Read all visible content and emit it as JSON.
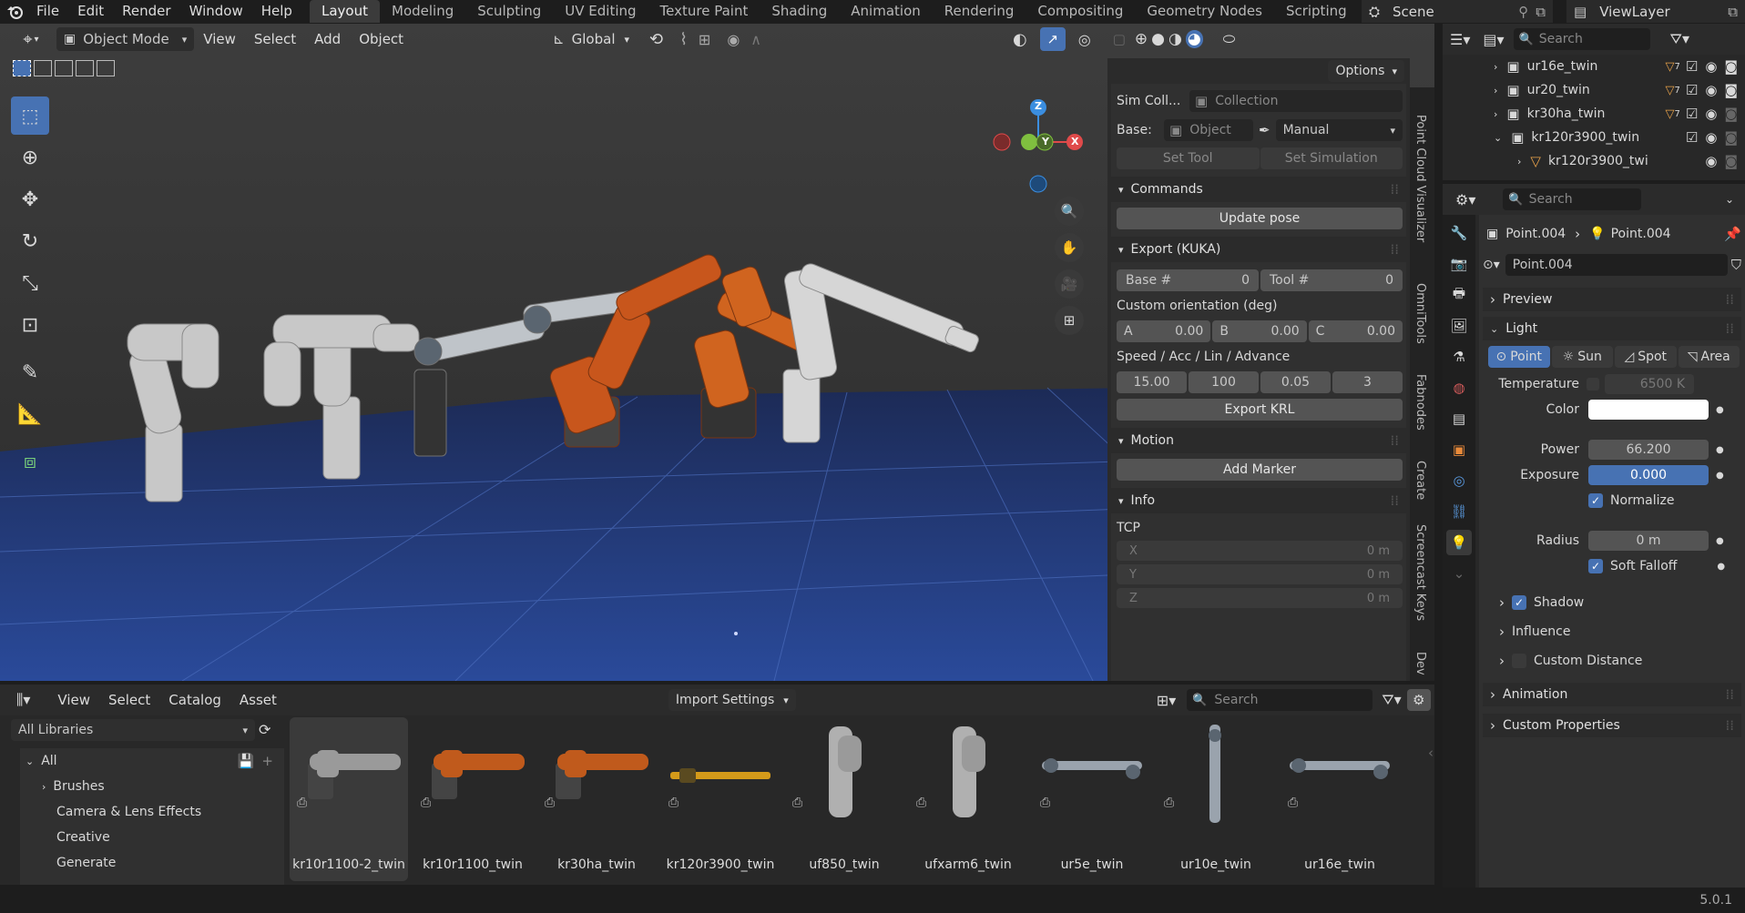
{
  "topbar": {
    "menus": [
      "File",
      "Edit",
      "Render",
      "Window",
      "Help"
    ],
    "workspaces": [
      "Layout",
      "Modeling",
      "Sculpting",
      "UV Editing",
      "Texture Paint",
      "Shading",
      "Animation",
      "Rendering",
      "Compositing",
      "Geometry Nodes",
      "Scripting"
    ],
    "active_workspace": "Layout",
    "scene": "Scene",
    "view_layer": "ViewLayer"
  },
  "viewport": {
    "mode": "Object Mode",
    "menus": [
      "View",
      "Select",
      "Add",
      "Object"
    ],
    "transform_orientation": "Global",
    "options_label": "Options",
    "gizmo_axes": {
      "z": "Z",
      "y": "Y",
      "x": "X"
    }
  },
  "npanel": {
    "sim_coll_label": "Sim Coll...",
    "sim_coll_value": "Collection",
    "base_label": "Base:",
    "base_value": "Object",
    "base_mode": "Manual",
    "set_tool": "Set Tool",
    "set_simulation": "Set Simulation",
    "commands_title": "Commands",
    "update_pose": "Update pose",
    "export_title": "Export (KUKA)",
    "base_num_label": "Base #",
    "base_num_value": "0",
    "tool_num_label": "Tool #",
    "tool_num_value": "0",
    "custom_orientation_label": "Custom orientation (deg)",
    "orient_a_label": "A",
    "orient_a_value": "0.00",
    "orient_b_label": "B",
    "orient_b_value": "0.00",
    "orient_c_label": "C",
    "orient_c_value": "0.00",
    "speed_label": "Speed / Acc / Lin / Advance",
    "speed_values": [
      "15.00",
      "100",
      "0.05",
      "3"
    ],
    "export_krl": "Export KRL",
    "motion_title": "Motion",
    "add_marker": "Add Marker",
    "info_title": "Info",
    "tcp_label": "TCP",
    "tcp_x_label": "X",
    "tcp_x_value": "0 m",
    "tcp_y_label": "Y",
    "tcp_y_value": "0 m",
    "tcp_z_label": "Z",
    "tcp_z_value": "0 m"
  },
  "vtabs": [
    "Point Cloud Visualizer",
    "OmniTools",
    "Fabnodes",
    "Create",
    "Screencast Keys",
    "Dev"
  ],
  "outliner": {
    "search_placeholder": "Search",
    "rows": [
      {
        "name": "ur16e_twin",
        "badge": "7"
      },
      {
        "name": "ur20_twin",
        "badge": "7"
      },
      {
        "name": "kr30ha_twin",
        "badge": "7"
      },
      {
        "name": "kr120r3900_twin",
        "badge": ""
      },
      {
        "name": "kr120r3900_twi",
        "badge": ""
      }
    ]
  },
  "properties": {
    "search_placeholder": "Search",
    "breadcrumb_object": "Point.004",
    "breadcrumb_data": "Point.004",
    "datablock_name": "Point.004",
    "preview_title": "Preview",
    "light_title": "Light",
    "light_types": [
      "Point",
      "Sun",
      "Spot",
      "Area"
    ],
    "active_light_type": "Point",
    "temperature_label": "Temperature",
    "temperature_value": "6500 K",
    "color_label": "Color",
    "color_value": "#ffffff",
    "power_label": "Power",
    "power_value": "66.200",
    "exposure_label": "Exposure",
    "exposure_value": "0.000",
    "normalize_label": "Normalize",
    "radius_label": "Radius",
    "radius_value": "0 m",
    "soft_falloff_label": "Soft Falloff",
    "shadow_label": "Shadow",
    "influence_label": "Influence",
    "custom_distance_label": "Custom Distance",
    "animation_title": "Animation",
    "custom_props_title": "Custom Properties"
  },
  "asset_browser": {
    "menus": [
      "View",
      "Select",
      "Catalog",
      "Asset"
    ],
    "import_settings": "Import Settings",
    "search_placeholder": "Search",
    "library": "All Libraries",
    "catalog_root": "All",
    "catalogs": [
      "Brushes",
      "Camera & Lens Effects",
      "Creative",
      "Generate"
    ],
    "assets": [
      {
        "name": "kr10r1100-2_twin",
        "color": "#9a9a9a",
        "kind": "arm"
      },
      {
        "name": "kr10r1100_twin",
        "color": "#c05a1c",
        "kind": "arm"
      },
      {
        "name": "kr30ha_twin",
        "color": "#c05a1c",
        "kind": "arm"
      },
      {
        "name": "kr120r3900_twin",
        "color": "#d49a1a",
        "kind": "long"
      },
      {
        "name": "uf850_twin",
        "color": "#b0b0b0",
        "kind": "tall"
      },
      {
        "name": "ufxarm6_twin",
        "color": "#b0b0b0",
        "kind": "tall"
      },
      {
        "name": "ur5e_twin",
        "color": "#9aa3ad",
        "kind": "ur"
      },
      {
        "name": "ur10e_twin",
        "color": "#9aa3ad",
        "kind": "pole"
      },
      {
        "name": "ur16e_twin",
        "color": "#9aa3ad",
        "kind": "ur"
      }
    ]
  },
  "status": {
    "version": "5.0.1"
  }
}
